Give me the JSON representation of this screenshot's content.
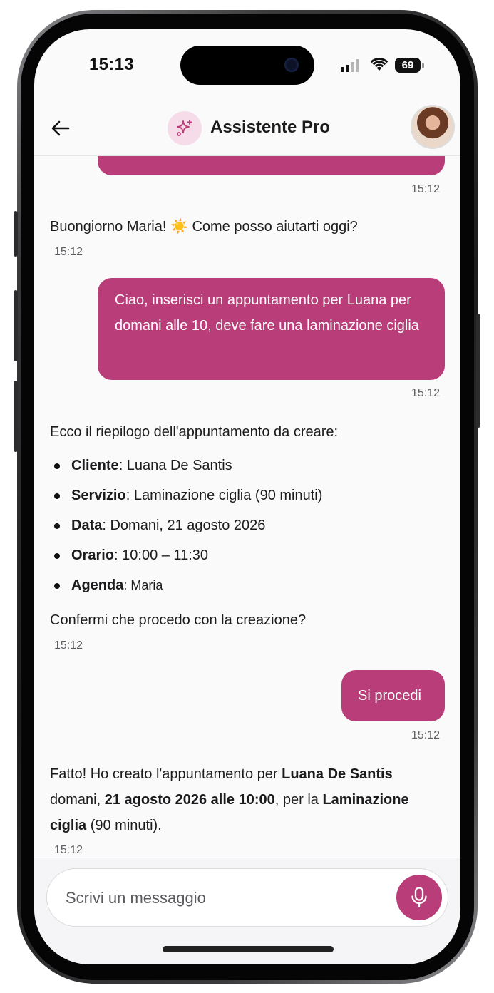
{
  "status_bar": {
    "time": "15:13",
    "battery": "69"
  },
  "header": {
    "title": "Assistente Pro",
    "back_icon": "arrow-left-icon",
    "badge_icon": "sparkles-icon"
  },
  "colors": {
    "accent": "#b83d78",
    "badge_bg": "#f6dce8"
  },
  "messages": [
    {
      "role": "user",
      "time": "15:12"
    },
    {
      "role": "bot",
      "text": "Buongiorno Maria! ☀️ Come posso aiutarti oggi?",
      "time": "15:12"
    },
    {
      "role": "user",
      "text": "Ciao, inserisci un appuntamento per Luana per domani alle 10, deve fare una laminazione ciglia",
      "time": "15:12"
    },
    {
      "role": "bot",
      "intro": "Ecco il riepilogo dell'appuntamento da creare:",
      "items": [
        {
          "key": "Cliente",
          "value": ": Luana De Santis"
        },
        {
          "key": "Servizio",
          "value": ": Laminazione ciglia (90 minuti)"
        },
        {
          "key": "Data",
          "value": ": Domani, 21 agosto 2026"
        },
        {
          "key": "Orario",
          "value": ": 10:00 – 11:30"
        },
        {
          "key": "Agenda",
          "value": ": Maria"
        }
      ],
      "outro": "Confermi che procedo con la creazione?",
      "time": "15:12"
    },
    {
      "role": "user",
      "text": "Si procedi",
      "time": "15:12"
    },
    {
      "role": "bot",
      "parts": [
        "Fatto! Ho creato l'appuntamento per ",
        "Luana De Santis",
        " domani, ",
        "21 agosto 2026 alle 10:00",
        ", per la ",
        "Laminazione ciglia",
        " (90 minuti)."
      ],
      "time": "15:12"
    }
  ],
  "composer": {
    "placeholder": "Scrivi un messaggio",
    "mic_icon": "microphone-icon"
  }
}
